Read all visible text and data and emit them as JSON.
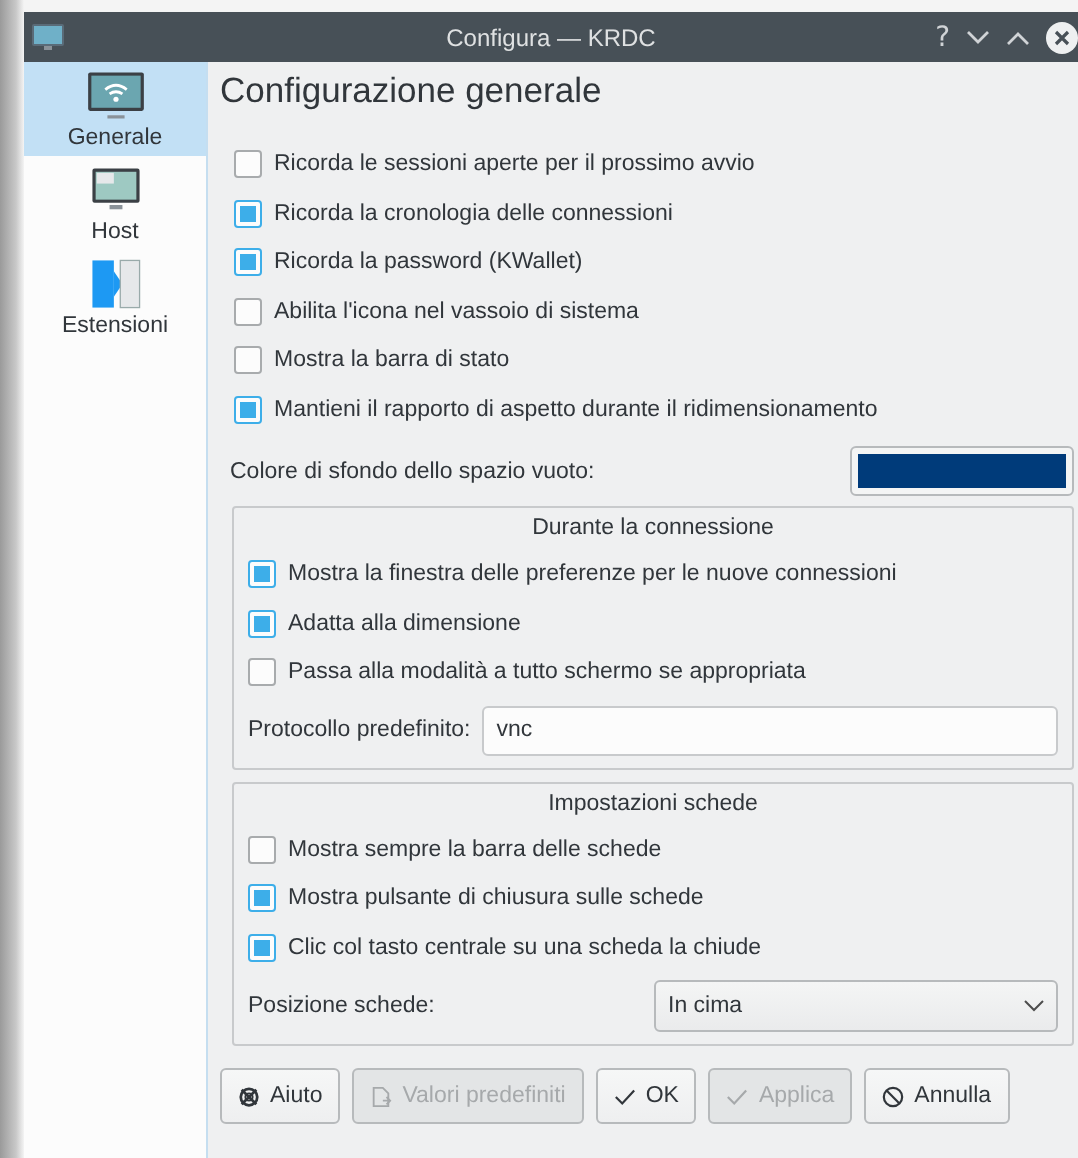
{
  "window": {
    "title": "Configura — KRDC",
    "help": "?"
  },
  "sidebar": {
    "items": [
      {
        "label": "Generale",
        "kind": "wifi-monitor",
        "selected": true
      },
      {
        "label": "Host",
        "kind": "monitor",
        "selected": false
      },
      {
        "label": "Estensioni",
        "kind": "plugin",
        "selected": false
      }
    ]
  },
  "heading": "Configurazione generale",
  "options": [
    {
      "label": "Ricorda le sessioni aperte per il prossimo avvio",
      "checked": false
    },
    {
      "label": "Ricorda la cronologia delle connessioni",
      "checked": true
    },
    {
      "label": "Ricorda la password (KWallet)",
      "checked": true
    },
    {
      "label": "Abilita l'icona nel vassoio di sistema",
      "checked": false
    },
    {
      "label": "Mostra la barra di stato",
      "checked": false
    },
    {
      "label": "Mantieni il rapporto di aspetto durante il ridimensionamento",
      "checked": true
    }
  ],
  "background_color": {
    "label": "Colore di sfondo dello spazio vuoto:",
    "color": "#003b7a"
  },
  "groups": [
    {
      "title": "Durante la connessione",
      "options": [
        {
          "label": "Mostra la finestra delle preferenze per le nuove connessioni",
          "checked": true
        },
        {
          "label": "Adatta alla dimensione",
          "checked": true
        },
        {
          "label": "Passa alla modalità a tutto schermo se appropriata",
          "checked": false
        }
      ],
      "field": {
        "kind": "text",
        "label": "Protocollo predefinito:",
        "value": "vnc"
      }
    },
    {
      "title": "Impostazioni schede",
      "options": [
        {
          "label": "Mostra sempre la barra delle schede",
          "checked": false
        },
        {
          "label": "Mostra pulsante di chiusura sulle schede",
          "checked": true
        },
        {
          "label": "Clic col tasto centrale su una scheda la chiude",
          "checked": true
        }
      ],
      "field": {
        "kind": "combo",
        "label": "Posizione schede:",
        "value": "In cima"
      }
    }
  ],
  "buttons": [
    {
      "label": "Aiuto",
      "kind": "help",
      "disabled": false
    },
    {
      "label": "Valori predefiniti",
      "kind": "defaults",
      "disabled": true
    },
    {
      "label": "OK",
      "kind": "ok",
      "disabled": false
    },
    {
      "label": "Applica",
      "kind": "apply",
      "disabled": true
    },
    {
      "label": "Annulla",
      "kind": "cancel",
      "disabled": false
    }
  ]
}
